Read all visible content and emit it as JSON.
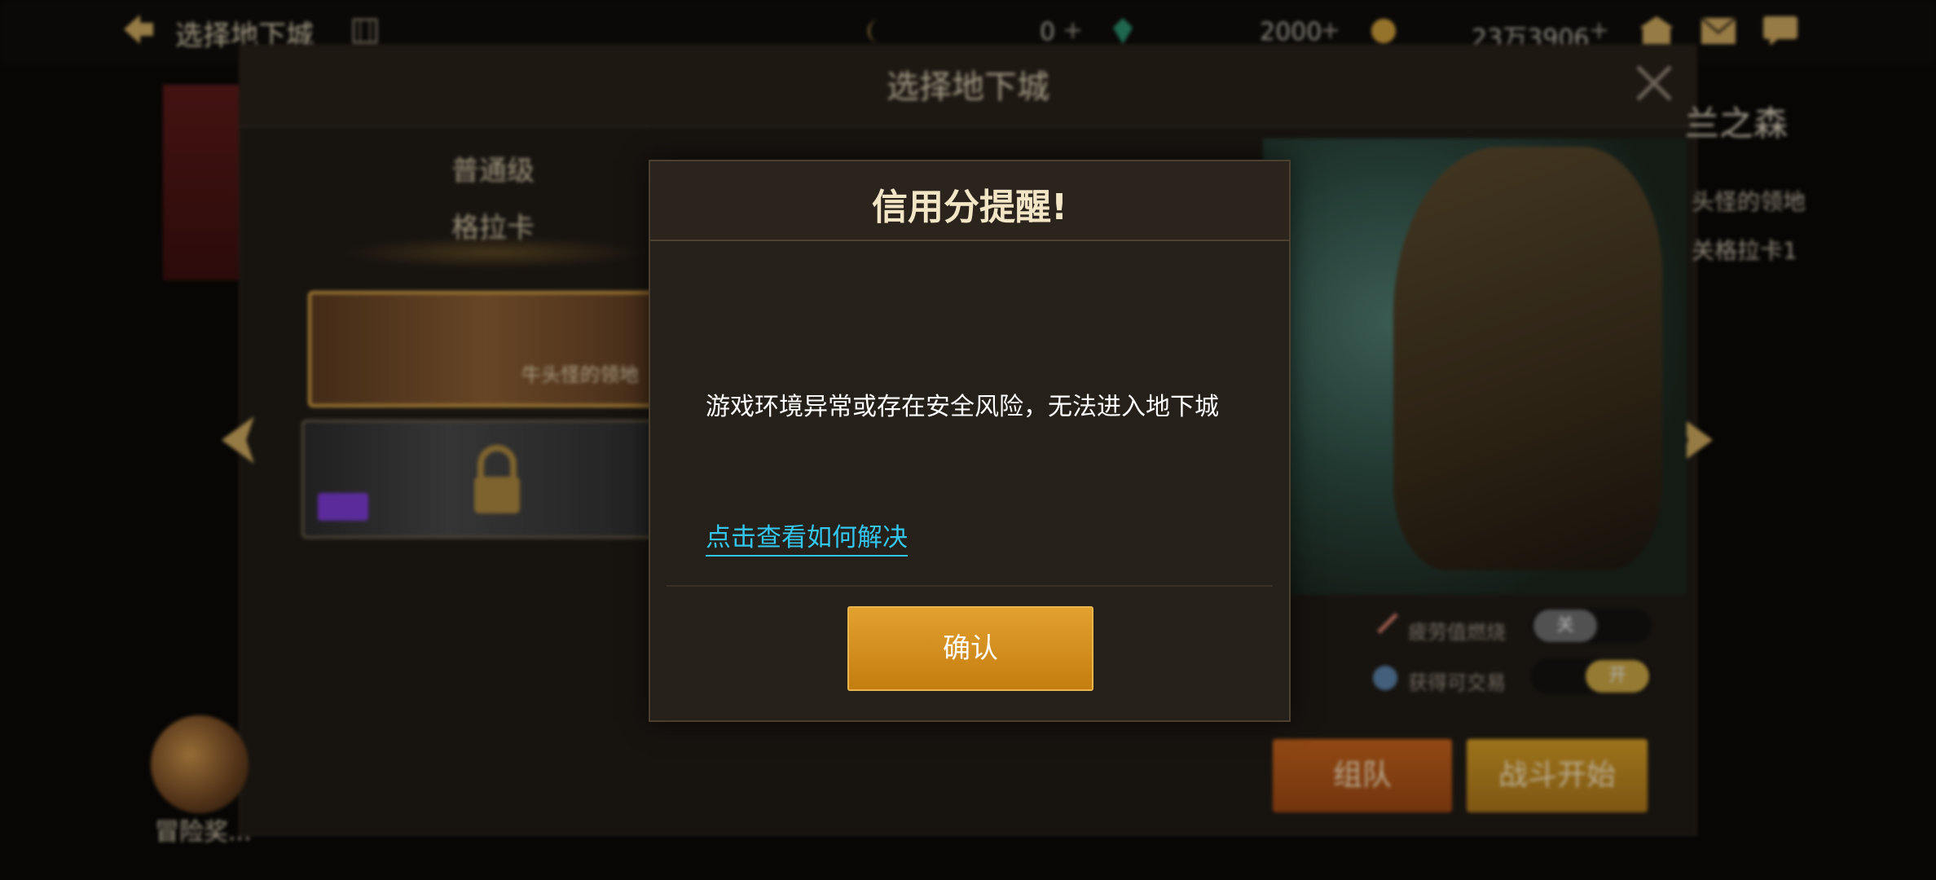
{
  "topbar": {
    "title": "选择地下城",
    "resource1_value": "0",
    "resource2_value": "2000",
    "resource3_value": "23万3906",
    "plus_glyph": "+"
  },
  "panel": {
    "title": "选择地下城",
    "tab_top": "普通级",
    "tab_bottom": "格拉卡",
    "card1_name": "牛头怪的领地",
    "right_title": "兰之森",
    "right_line1": "头怪的领地",
    "right_line2": "关格拉卡1",
    "toggle1_label": "疲劳值燃烧",
    "toggle1_state": "关",
    "toggle2_label": "获得可交易",
    "toggle2_state": "开",
    "team_button": "组队",
    "start_button": "战斗开始",
    "chest_label": "冒险奖..."
  },
  "dialog": {
    "title": "信用分提醒!",
    "message": "游戏环境异常或存在安全风险，无法进入地下城",
    "help_link": "点击查看如何解决",
    "confirm_button": "确认"
  },
  "colors": {
    "accent_gold": "#d49a24",
    "link_blue": "#33c6ee",
    "dialog_bg": "#26201a"
  }
}
